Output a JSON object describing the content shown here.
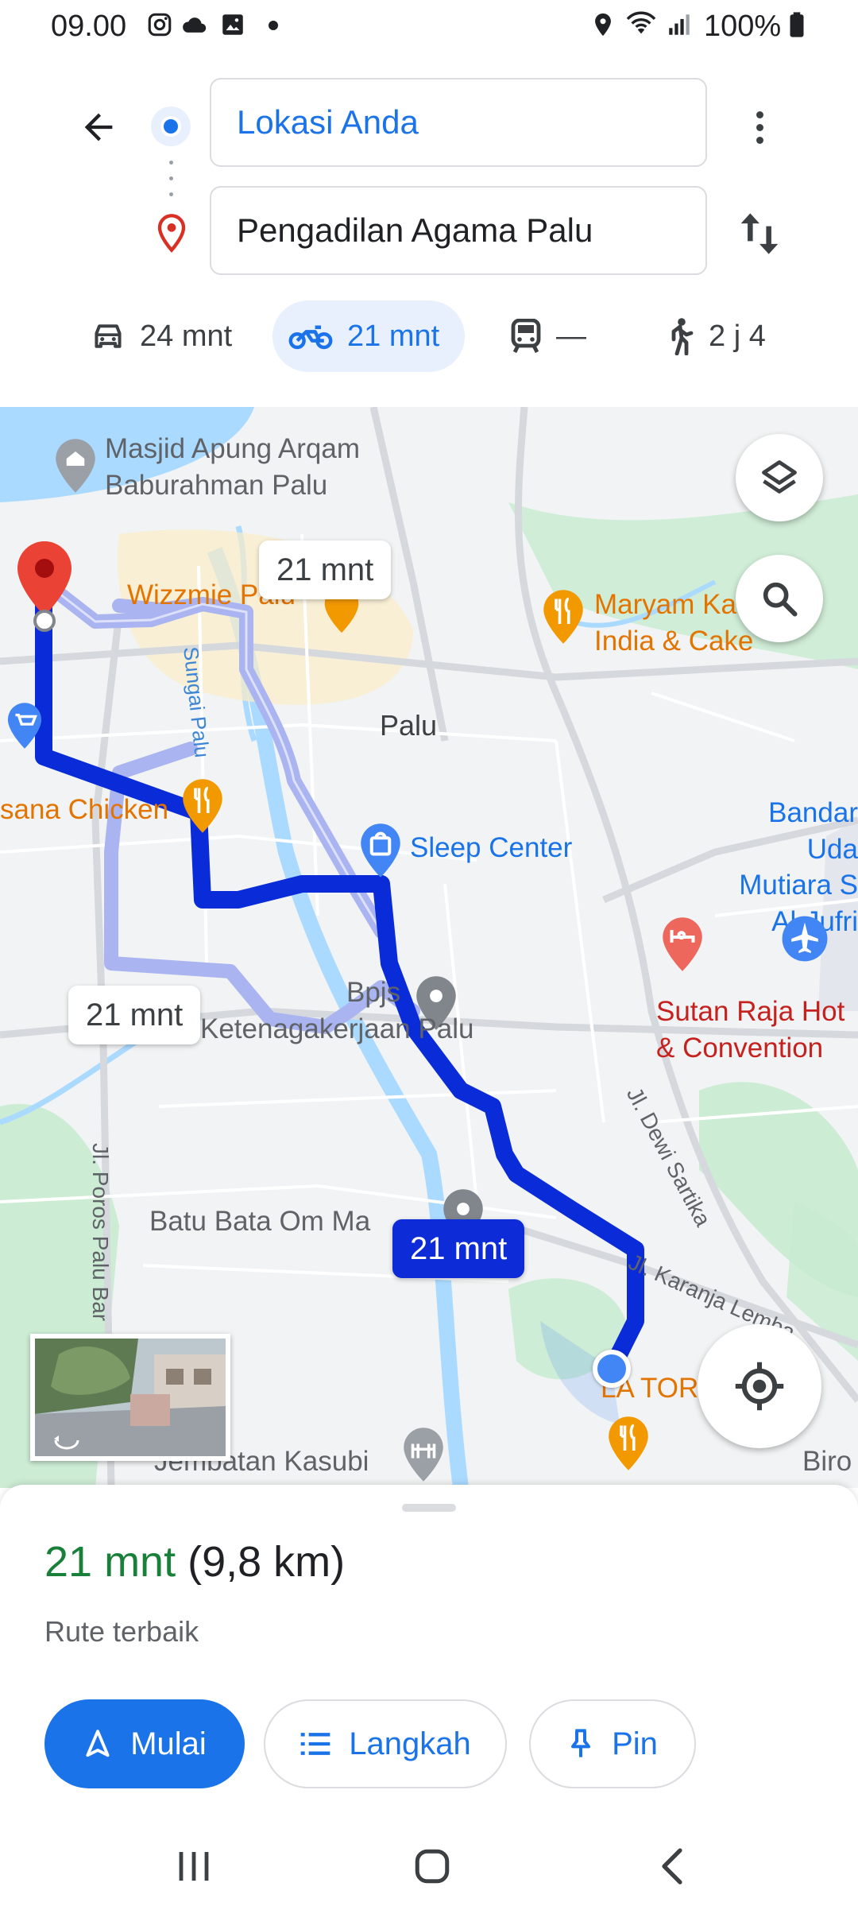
{
  "status_bar": {
    "time": "09.00",
    "battery": "100%",
    "icons": [
      "instagram-icon",
      "cloud-icon",
      "gallery-icon",
      "dot-icon",
      "location-icon",
      "wifi-icon",
      "signal-icon",
      "battery-icon"
    ]
  },
  "directions": {
    "origin": "Lokasi Anda",
    "destination": "Pengadilan Agama Palu",
    "modes": [
      {
        "icon": "car-icon",
        "label": "24 mnt",
        "active": false
      },
      {
        "icon": "motorcycle-icon",
        "label": "21 mnt",
        "active": true
      },
      {
        "icon": "transit-icon",
        "label": "—",
        "active": false
      },
      {
        "icon": "walk-icon",
        "label": "2 j 4",
        "active": false
      }
    ]
  },
  "map": {
    "labels": {
      "masjid": "Masjid Apung Arqam\nBaburahman Palu",
      "wizzmie": "Wizzmie Palu",
      "maryam": "Maryam Ka\nIndia & Cake",
      "palu": "Palu",
      "sungai": "Sungai Palu",
      "chicken": "sana Chicken",
      "sleep_center": "Sleep Center",
      "bandar": "Bandar Uda\nMutiara S\nAl-Jufri",
      "bpjs": "Bpjs",
      "ketenagakerjaan": "Ketenagakerjaan Palu",
      "sutan": "Sutan Raja Hot\n& Convention",
      "dewi_sartika": "Jl. Dewi Sartika",
      "poros": "Jl. Poros Palu Bar",
      "batu_bata": "Batu Bata Om Ma",
      "karanja": "Jl. Karanja Lemba",
      "la_tor": "LA TOR",
      "jembatan": "Jembatan Kasubi",
      "biro": "Biro"
    },
    "route_chips": {
      "top": "21 mnt",
      "left": "21 mnt",
      "selected": "21 mnt"
    },
    "colors": {
      "route_selected": "#0a2bd8",
      "route_alt": "#a9b4f0",
      "water": "#aadaff",
      "park": "#c8ebd0"
    }
  },
  "sheet": {
    "duration": "21 mnt",
    "distance": "(9,8 km)",
    "description": "Rute terbaik",
    "buttons": {
      "start": "Mulai",
      "steps": "Langkah",
      "pin": "Pin"
    }
  }
}
